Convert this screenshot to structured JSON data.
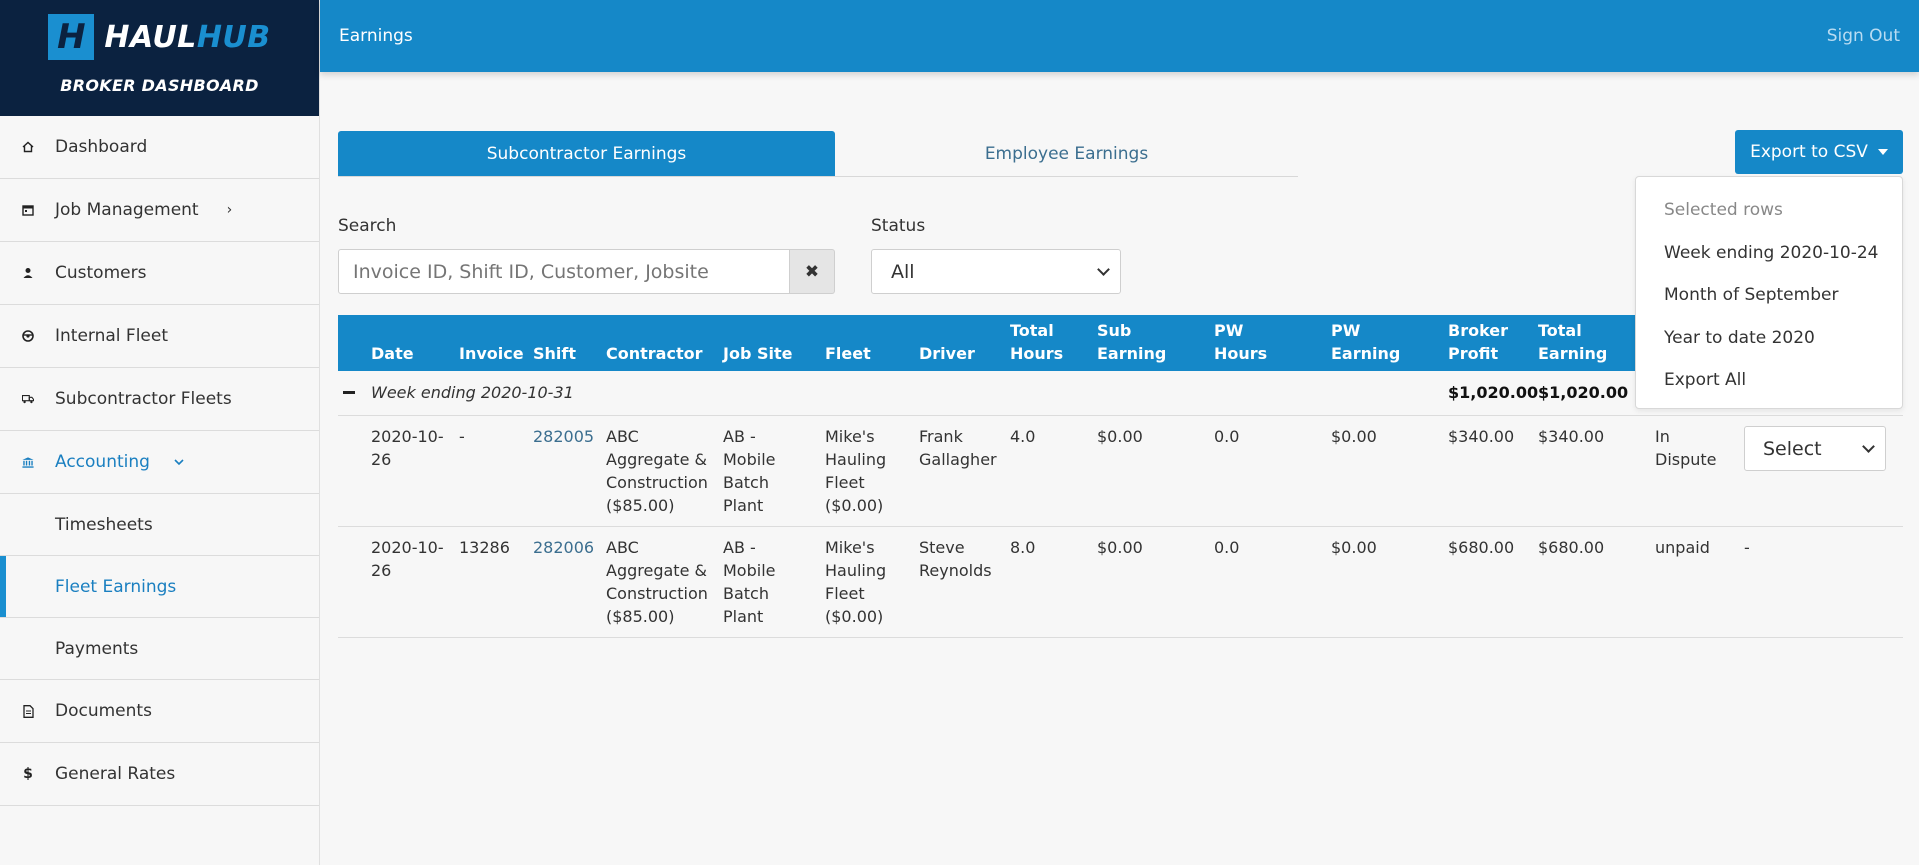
{
  "brand": {
    "logo_part1": "HAUL",
    "logo_part2": "HUB",
    "logo_mark": "H",
    "subtitle": "BROKER DASHBOARD"
  },
  "topbar": {
    "title": "Earnings",
    "sign_out": "Sign Out"
  },
  "sidebar": {
    "items": [
      {
        "label": "Dashboard",
        "icon": "home-icon"
      },
      {
        "label": "Job Management",
        "icon": "calendar-icon"
      },
      {
        "label": "Customers",
        "icon": "user-icon"
      },
      {
        "label": "Internal Fleet",
        "icon": "steering-wheel-icon"
      },
      {
        "label": "Subcontractor Fleets",
        "icon": "truck-icon"
      },
      {
        "label": "Accounting",
        "icon": "bank-icon"
      },
      {
        "label": "Documents",
        "icon": "document-icon"
      },
      {
        "label": "General Rates",
        "icon": "dollar-icon"
      }
    ],
    "accounting_sub": [
      "Timesheets",
      "Fleet Earnings",
      "Payments"
    ]
  },
  "tabs": {
    "subcontractor": "Subcontractor Earnings",
    "employee": "Employee Earnings"
  },
  "export": {
    "button_label": "Export to CSV",
    "menu": [
      "Selected rows",
      "Week ending 2020-10-24",
      "Month of September",
      "Year to date 2020",
      "Export All"
    ]
  },
  "filters": {
    "search_label": "Search",
    "search_placeholder": "Invoice ID, Shift ID, Customer, Jobsite",
    "status_label": "Status",
    "status_value": "All"
  },
  "table": {
    "headers": {
      "date": "Date",
      "invoice": "Invoice",
      "shift": "Shift",
      "contractor": "Contractor",
      "job_site": "Job Site",
      "fleet": "Fleet",
      "driver": "Driver",
      "total_hours_1": "Total",
      "total_hours_2": "Hours",
      "sub_earning_1": "Sub",
      "sub_earning_2": "Earning",
      "pw_hours_1": "PW",
      "pw_hours_2": "Hours",
      "pw_earning_1": "PW",
      "pw_earning_2": "Earning",
      "broker_profit_1": "Broker",
      "broker_profit_2": "Profit",
      "total_earning_1": "Total",
      "total_earning_2": "Earning"
    },
    "group": {
      "label": "Week ending 2020-10-31",
      "broker_profit": "$1,020.00",
      "total_earning": "$1,020.00"
    },
    "rows": [
      {
        "date_1": "2020-10-",
        "date_2": "26",
        "invoice": "-",
        "shift": "282005",
        "contractor_1": "ABC",
        "contractor_2": "Aggregate &",
        "contractor_3": "Construction",
        "contractor_4": "($85.00)",
        "job_1": "AB -",
        "job_2": "Mobile",
        "job_3": "Batch",
        "job_4": "Plant",
        "fleet_1": "Mike's",
        "fleet_2": "Hauling",
        "fleet_3": "Fleet",
        "fleet_4": "($0.00)",
        "driver_1": "Frank",
        "driver_2": "Gallagher",
        "total_hours": "4.0",
        "sub_earning": "$0.00",
        "pw_hours": "0.0",
        "pw_earning": "$0.00",
        "broker_profit": "$340.00",
        "total_earning": "$340.00",
        "status_1": "In",
        "status_2": "Dispute",
        "action": "Select"
      },
      {
        "date_1": "2020-10-",
        "date_2": "26",
        "invoice": "13286",
        "shift": "282006",
        "contractor_1": "ABC",
        "contractor_2": "Aggregate &",
        "contractor_3": "Construction",
        "contractor_4": "($85.00)",
        "job_1": "AB -",
        "job_2": "Mobile",
        "job_3": "Batch",
        "job_4": "Plant",
        "fleet_1": "Mike's",
        "fleet_2": "Hauling",
        "fleet_3": "Fleet",
        "fleet_4": "($0.00)",
        "driver_1": "Steve",
        "driver_2": "Reynolds",
        "total_hours": "8.0",
        "sub_earning": "$0.00",
        "pw_hours": "0.0",
        "pw_earning": "$0.00",
        "broker_profit": "$680.00",
        "total_earning": "$680.00",
        "status_1": "unpaid",
        "status_2": "",
        "action": "-"
      }
    ]
  }
}
